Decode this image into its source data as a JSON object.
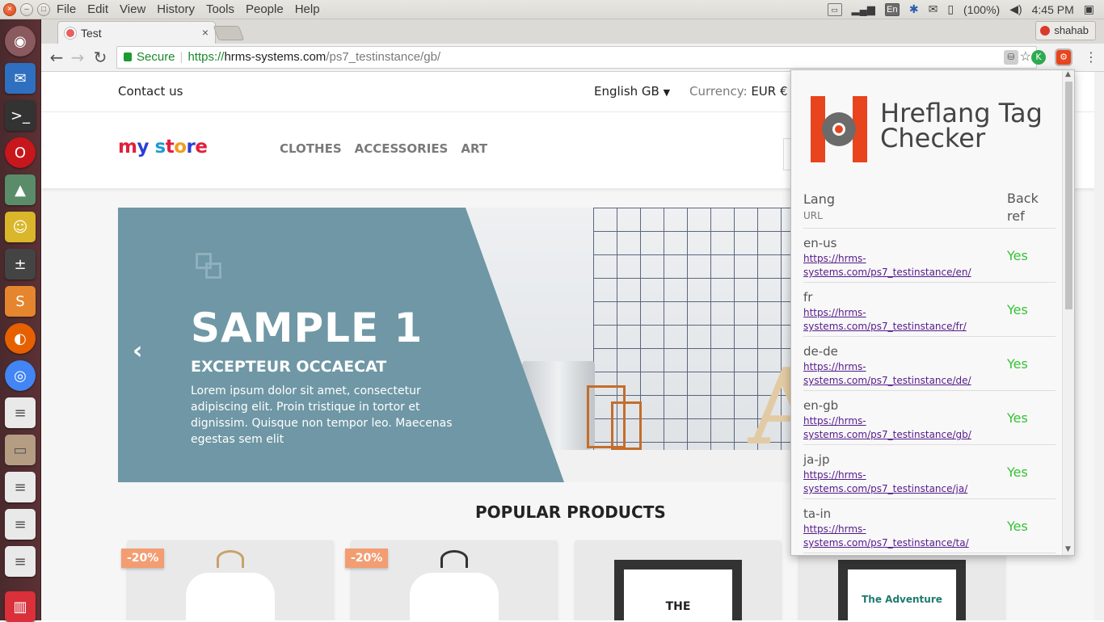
{
  "topbar": {
    "menus": [
      "File",
      "Edit",
      "View",
      "History",
      "Tools",
      "People",
      "Help"
    ],
    "tray": {
      "keyboard": "En",
      "battery": "(100%)",
      "time": "4:45 PM"
    }
  },
  "browser": {
    "tab_title": "Test",
    "tab_close": "×",
    "profile_name": "shahab",
    "secure_label": "Secure",
    "url_scheme": "https://",
    "url_domain": "hrms-systems.com",
    "url_path": "/ps7_testinstance/gb/"
  },
  "site": {
    "contact": "Contact us",
    "language": "English GB",
    "currency_label": "Currency:",
    "currency_value": "EUR €",
    "logo": "my store",
    "nav": [
      "CLOTHES",
      "ACCESSORIES",
      "ART"
    ],
    "slide": {
      "title": "SAMPLE 1",
      "subtitle": "EXCEPTEUR OCCAECAT",
      "text": "Lorem ipsum dolor sit amet, consectetur adipiscing elit. Proin tristique in tortor et dignissim. Quisque non tempor leo. Maecenas egestas sem elit"
    },
    "section_title": "POPULAR PRODUCTS",
    "products": [
      {
        "discount": "-20%"
      },
      {
        "discount": "-20%"
      },
      {
        "frame_text": "THE"
      },
      {
        "frame_text": "The Adventure"
      }
    ]
  },
  "popup": {
    "title_line1": "Hreflang Tag",
    "title_line2": "Checker",
    "col_lang": "Lang",
    "col_url": "URL",
    "col_back": "Back ref",
    "rows": [
      {
        "lang": "en-us",
        "url": "https://hrms-systems.com/ps7_testinstance/en/",
        "back": "Yes"
      },
      {
        "lang": "fr",
        "url": "https://hrms-systems.com/ps7_testinstance/fr/",
        "back": "Yes"
      },
      {
        "lang": "de-de",
        "url": "https://hrms-systems.com/ps7_testinstance/de/",
        "back": "Yes"
      },
      {
        "lang": "en-gb",
        "url": "https://hrms-systems.com/ps7_testinstance/gb/",
        "back": "Yes"
      },
      {
        "lang": "ja-jp",
        "url": "https://hrms-systems.com/ps7_testinstance/ja/",
        "back": "Yes"
      },
      {
        "lang": "ta-in",
        "url": "https://hrms-systems.com/ps7_testinstance/ta/",
        "back": "Yes"
      }
    ]
  },
  "colors": {
    "accent_green": "#35c235",
    "link": "#551a8b",
    "brand_orange": "#e8441d",
    "slide_blue": "#6f97a5"
  }
}
